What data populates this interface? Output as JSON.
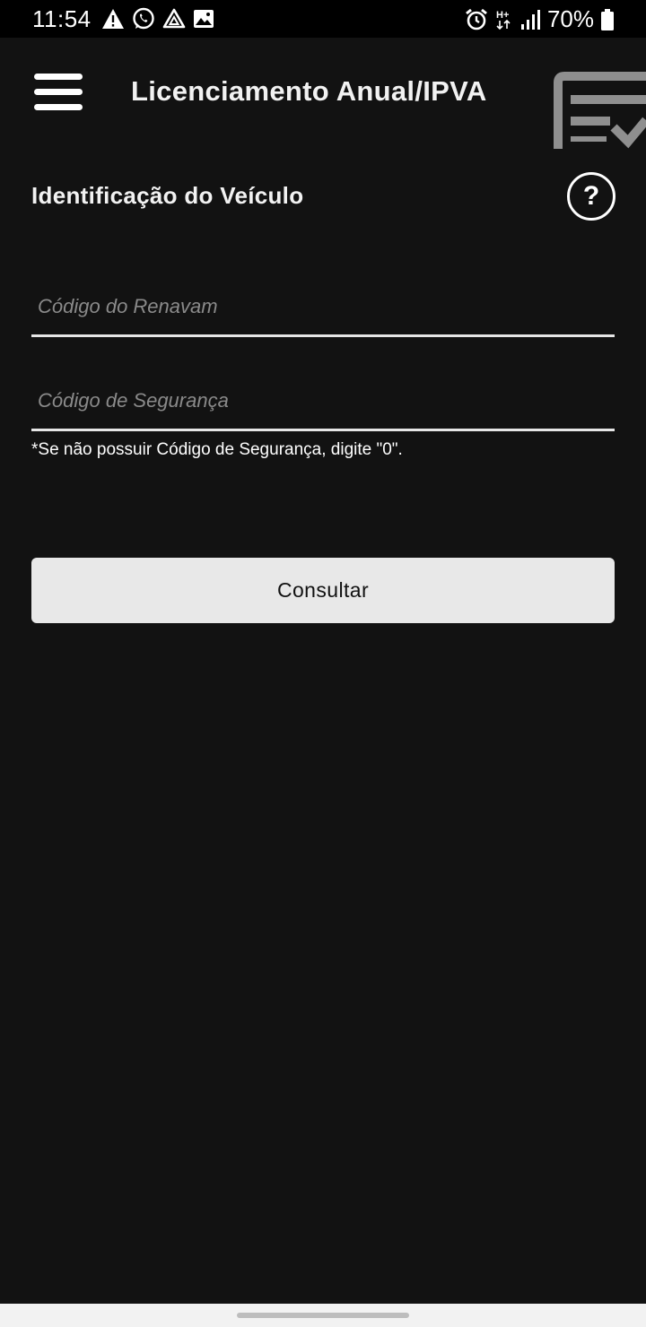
{
  "status_bar": {
    "time": "11:54",
    "battery": "70%",
    "left_icons": [
      "warning-icon",
      "whatsapp-icon",
      "drive-icon",
      "image-icon"
    ],
    "right_icons": [
      "alarm-icon",
      "network-h-plus-icon",
      "signal-icon",
      "battery-icon"
    ]
  },
  "app_bar": {
    "title": "Licenciamento Anual/IPVA",
    "menu_icon": "hamburger-menu-icon",
    "right_icon": "document-check-icon"
  },
  "form": {
    "section_title": "Identificação do Veículo",
    "help_label": "?",
    "renavam_placeholder": "Código do Renavam",
    "renavam_value": "",
    "seguranca_placeholder": "Código de Segurança",
    "seguranca_value": "",
    "hint": "*Se não possuir Código de Segurança, digite \"0\".",
    "submit_label": "Consultar"
  },
  "colors": {
    "background": "#121212",
    "status_bar": "#000000",
    "button_bg": "#e8e8e8",
    "text": "#ffffff",
    "placeholder": "#8a8a8a"
  }
}
